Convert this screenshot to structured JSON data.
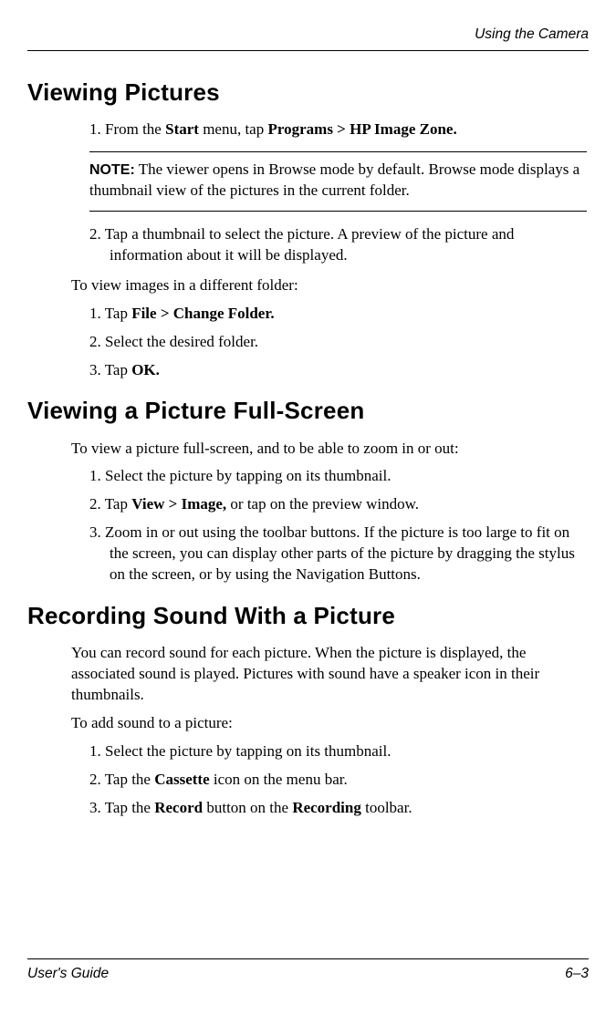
{
  "running_header": "Using the Camera",
  "sections": {
    "viewing_pictures": {
      "title": "Viewing Pictures",
      "step1_num": "1. ",
      "step1_a": "From the ",
      "step1_b": "Start",
      "step1_c": " menu, tap ",
      "step1_d": "Programs > HP Image Zone.",
      "note_label": "NOTE:",
      "note_body": " The viewer opens in Browse mode by default. Browse mode displays a thumbnail view of the pictures in the current folder.",
      "step2_num": "2. ",
      "step2_body": "Tap a thumbnail to select the picture. A preview of the picture and information about it will be displayed.",
      "diff_folder_intro": "To view images in a different folder:",
      "df1_num": "1. ",
      "df1_a": "Tap ",
      "df1_b": "File > Change Folder.",
      "df2_num": "2. ",
      "df2_body": "Select the desired folder.",
      "df3_num": "3. ",
      "df3_a": "Tap ",
      "df3_b": "OK."
    },
    "fullscreen": {
      "title": "Viewing a Picture Full-Screen",
      "intro": "To view a picture full-screen, and to be able to zoom in or out:",
      "s1_num": "1. ",
      "s1_body": "Select the picture by tapping on its thumbnail.",
      "s2_num": "2. ",
      "s2_a": "Tap ",
      "s2_b": "View > Image,",
      "s2_c": " or tap on the preview window.",
      "s3_num": "3. ",
      "s3_body": "Zoom in or out using the toolbar buttons. If the picture is too large to fit on the screen, you can display other parts of the picture by dragging the stylus on the screen, or by using the Navigation Buttons."
    },
    "recording": {
      "title": "Recording Sound With a Picture",
      "intro": "You can record sound for each picture. When the picture is displayed, the associated sound is played. Pictures with sound have a speaker icon in their thumbnails.",
      "add_intro": "To add sound to a picture:",
      "s1_num": "1. ",
      "s1_body": "Select the picture by tapping on its thumbnail.",
      "s2_num": "2. ",
      "s2_a": "Tap the ",
      "s2_b": "Cassette",
      "s2_c": " icon on the menu bar.",
      "s3_num": "3. ",
      "s3_a": "Tap the ",
      "s3_b": "Record",
      "s3_c": " button on the ",
      "s3_d": "Recording",
      "s3_e": " toolbar."
    }
  },
  "footer": {
    "left": "User's Guide",
    "right": "6–3"
  }
}
